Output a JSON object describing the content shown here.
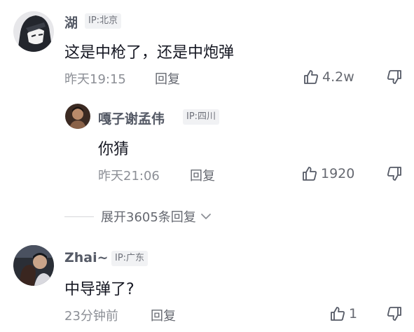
{
  "comments": [
    {
      "username": "湖",
      "ip": "IP:北京",
      "text": "这是中枪了，还是中炮弹",
      "time": "昨天19:15",
      "reply_label": "回复",
      "likes": "4.2w",
      "avatar": "dark-anime-avatar",
      "replies": [
        {
          "username": "嘎子谢孟伟",
          "ip": "IP:四川",
          "text": "你猜",
          "time": "昨天21:06",
          "reply_label": "回复",
          "likes": "1920",
          "avatar": "portrait-avatar"
        }
      ],
      "expand_label": "展开3605条回复"
    },
    {
      "username": "Zhai~",
      "ip": "IP:广东",
      "text": "中导弹了?",
      "time": "23分钟前",
      "reply_label": "回复",
      "likes": "1",
      "avatar": "couple-photo-avatar"
    }
  ],
  "colors": {
    "name": "#555a66",
    "meta": "#8c8f96",
    "text": "#161823",
    "ip_bg": "#f1f2f4"
  },
  "icons": [
    "thumbs-up-icon",
    "thumbs-down-icon",
    "chevron-down-icon"
  ]
}
